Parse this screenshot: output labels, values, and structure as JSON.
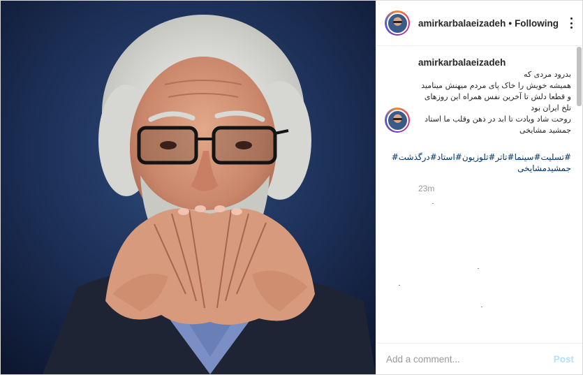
{
  "header": {
    "username": "amirkarbalaeizadeh",
    "separator": "•",
    "follow_status": "Following"
  },
  "caption": {
    "username": "amirkarbalaeizadeh",
    "lines": [
      "بدرود مردی که",
      "همیشه خویش را خاک پای مردم میهنش مینامید",
      "و قطعا دلش تا آخرین نفس همراه این روزهای",
      "تلخ ایران بود",
      "روحت شاد ویادت تا ابد در ذهن وقلب ما استاد",
      "جمشید مشایخی"
    ],
    "hashtags_line1": "#تسلیت#سینما#تاتر#تلوزیون#استاد#درگذشت#",
    "hashtags_line2": "جمشیدمشایخی",
    "timestamp": "23m"
  },
  "comment": {
    "placeholder": "Add a comment...",
    "post_label": "Post"
  },
  "colors": {
    "link": "#003569",
    "post_disabled": "#b2dffc",
    "muted": "#999999",
    "text": "#262626"
  },
  "icons": {
    "more": "more-options-icon"
  }
}
